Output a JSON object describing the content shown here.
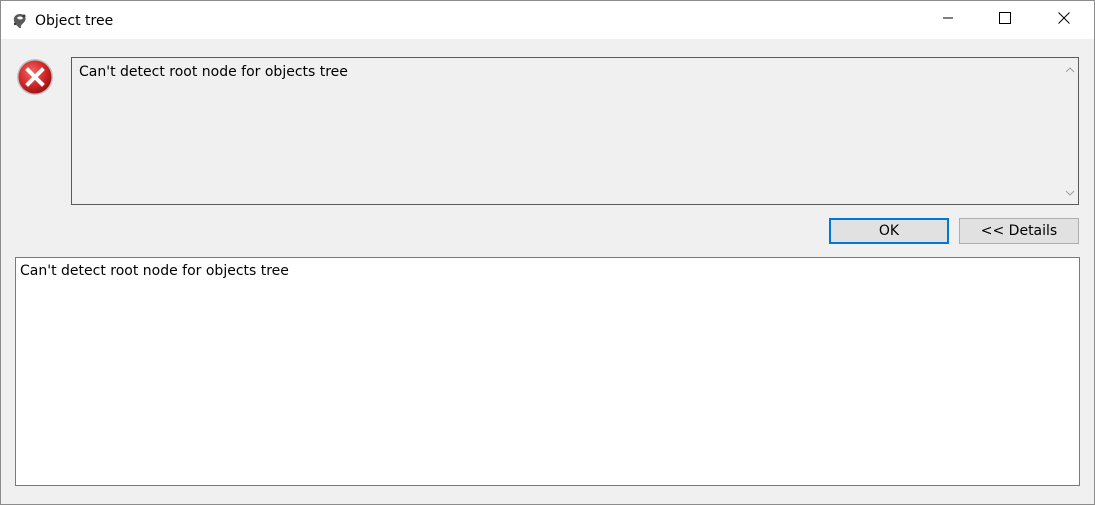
{
  "window": {
    "title": "Object tree"
  },
  "error": {
    "message": "Can't detect root node for objects tree",
    "details": "Can't detect root node for objects tree"
  },
  "buttons": {
    "ok_label": "OK",
    "details_label": "<< Details"
  },
  "icons": {
    "app": "app-logo-icon",
    "error": "error-icon",
    "minimize": "minimize-icon",
    "maximize": "maximize-icon",
    "close": "close-icon",
    "scroll_up": "chevron-up-icon",
    "scroll_down": "chevron-down-icon"
  },
  "colors": {
    "error_red": "#d42a2a",
    "focus_blue": "#0078d7",
    "dialog_bg": "#f0f0f0"
  }
}
